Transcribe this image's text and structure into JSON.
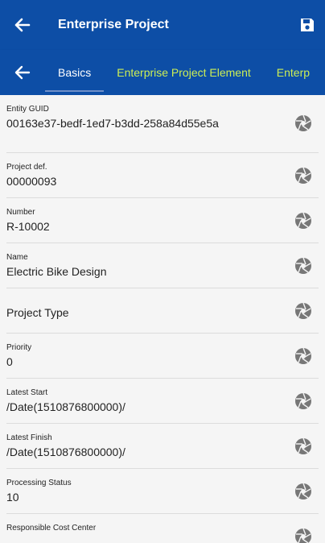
{
  "header": {
    "title": "Enterprise Project",
    "back_icon": "arrow-left-icon",
    "save_icon": "save-icon"
  },
  "tabs": {
    "back_icon": "arrow-left-icon",
    "items": [
      {
        "label": "Basics",
        "active": true
      },
      {
        "label": "Enterprise Project Element",
        "active": false
      },
      {
        "label": "Enterp",
        "active": false
      }
    ]
  },
  "fields": [
    {
      "label": "Entity GUID",
      "value": "00163e37-bedf-1ed7-b3dd-258a84d55e5a"
    },
    {
      "label": "Project def.",
      "value": "00000093"
    },
    {
      "label": "Number",
      "value": "R-10002"
    },
    {
      "label": "Name",
      "value": "Electric Bike Design"
    },
    {
      "label": "",
      "value": "Project Type"
    },
    {
      "label": "Priority",
      "value": "0"
    },
    {
      "label": "Latest Start",
      "value": "/Date(1510876800000)/"
    },
    {
      "label": "Latest Finish",
      "value": "/Date(1510876800000)/"
    },
    {
      "label": "Processing Status",
      "value": "10"
    },
    {
      "label": "Responsible Cost Center",
      "value": ""
    }
  ],
  "colors": {
    "primary": "#0d4ea6",
    "tab_inactive": "#ccee55",
    "icon": "#777777"
  }
}
